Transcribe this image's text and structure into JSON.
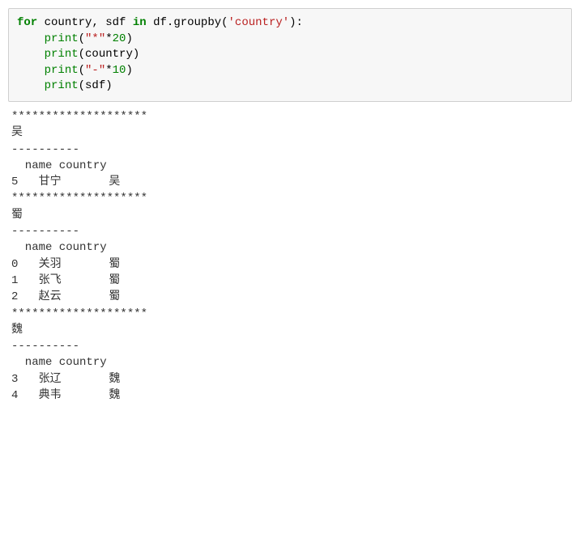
{
  "code": {
    "kw_for": "for",
    "var_country": "country",
    "comma": ",",
    "var_sdf": "sdf",
    "kw_in": "in",
    "var_df": "df",
    "meth_groupby": "groupby",
    "str_country": "'country'",
    "rparen_colon": "):",
    "print1_fn": "print",
    "print1_arg_str": "\"*\"",
    "print1_arg_op": "*",
    "print1_arg_num": "20",
    "print2_fn": "print",
    "print2_arg": "country",
    "print3_fn": "print",
    "print3_arg_str": "\"-\"",
    "print3_arg_op": "*",
    "print3_arg_num": "10",
    "print4_fn": "print",
    "print4_arg": "sdf"
  },
  "output": {
    "stars": "********************",
    "dashes": "----------",
    "header": "  name country",
    "groups": [
      {
        "country": "吴",
        "rows": [
          {
            "idx": "5",
            "name": "甘宁",
            "country": "吴"
          }
        ]
      },
      {
        "country": "蜀",
        "rows": [
          {
            "idx": "0",
            "name": "关羽",
            "country": "蜀"
          },
          {
            "idx": "1",
            "name": "张飞",
            "country": "蜀"
          },
          {
            "idx": "2",
            "name": "赵云",
            "country": "蜀"
          }
        ]
      },
      {
        "country": "魏",
        "rows": [
          {
            "idx": "3",
            "name": "张辽",
            "country": "魏"
          },
          {
            "idx": "4",
            "name": "典韦",
            "country": "魏"
          }
        ]
      }
    ]
  }
}
